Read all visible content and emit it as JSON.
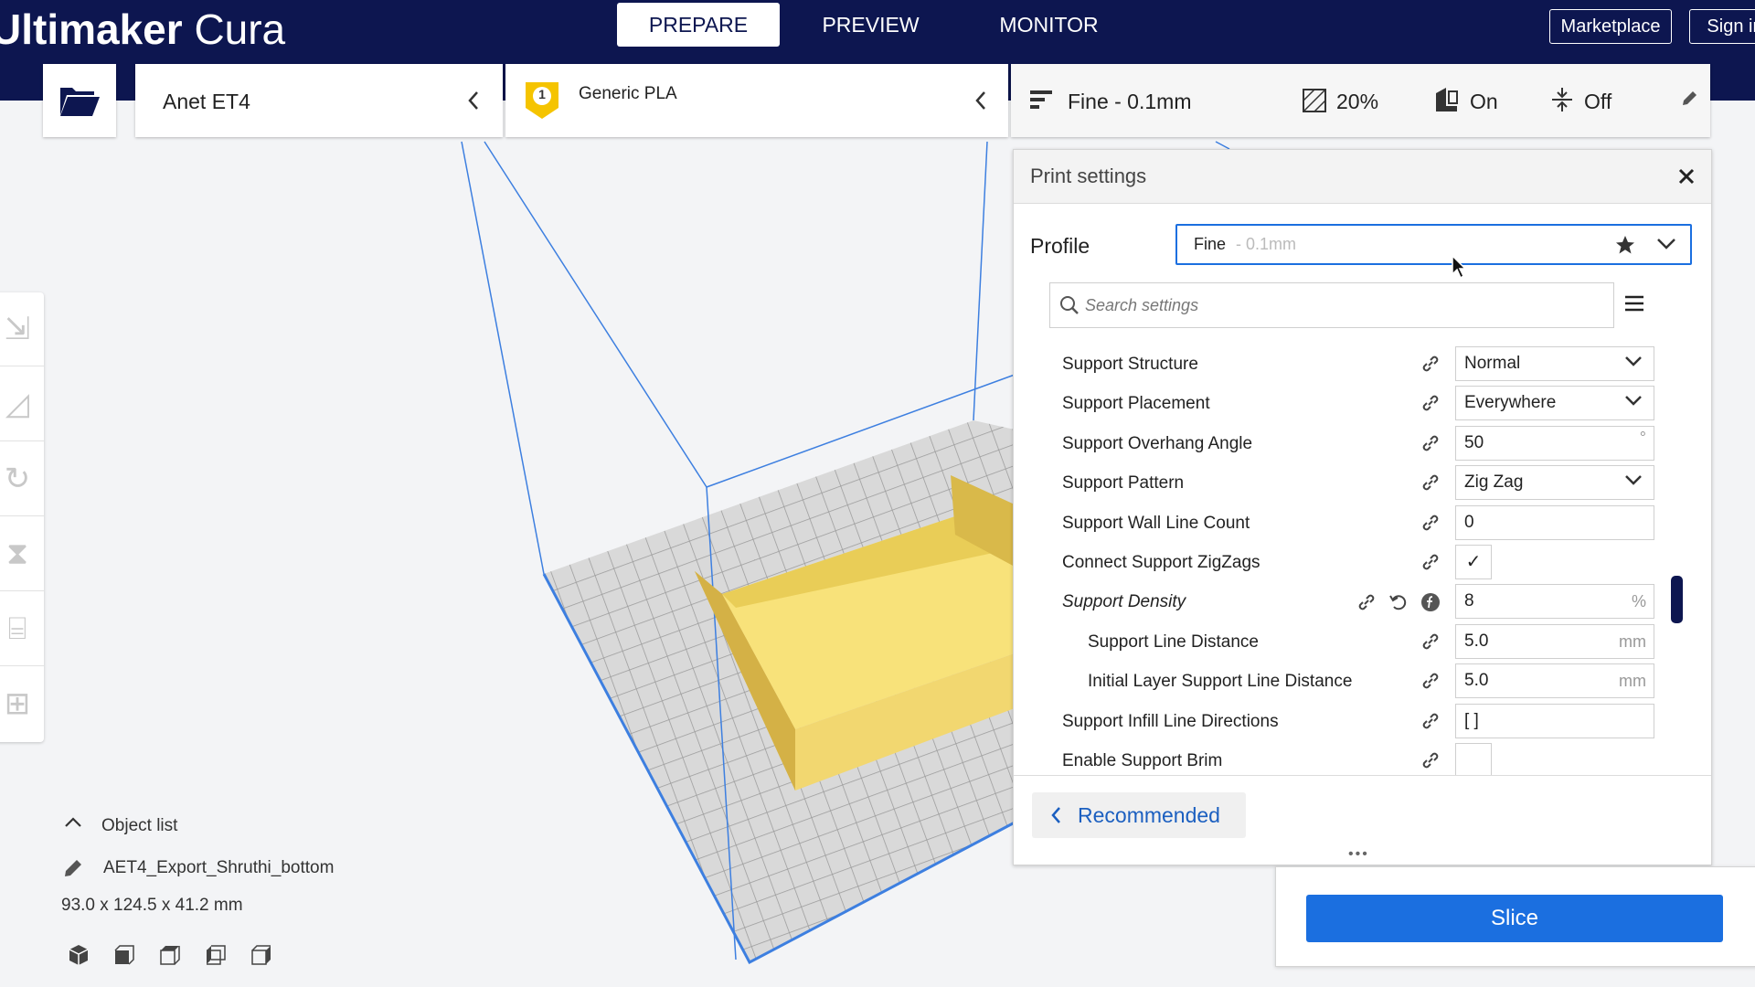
{
  "header": {
    "logo_bold": "Ultimaker",
    "logo_light": "Cura",
    "tabs": [
      "PREPARE",
      "PREVIEW",
      "MONITOR"
    ],
    "marketplace": "Marketplace",
    "sign_in": "Sign in"
  },
  "machine": {
    "printer": "Anet ET4",
    "material_badge": "1",
    "material": "Generic PLA"
  },
  "profile_bar": {
    "quality": "Fine - 0.1mm",
    "infill": "20%",
    "support": "On",
    "adhesion": "Off"
  },
  "panel": {
    "title": "Print settings",
    "profile_label": "Profile",
    "profile_name": "Fine",
    "profile_sub": "- 0.1mm",
    "search_placeholder": "Search settings",
    "recommended": "Recommended",
    "settings": [
      {
        "label": "Support Structure",
        "value": "Normal",
        "unit": ""
      },
      {
        "label": "Support Placement",
        "value": "Everywhere",
        "unit": ""
      },
      {
        "label": "Support Overhang Angle",
        "value": "50",
        "unit": "°"
      },
      {
        "label": "Support Pattern",
        "value": "Zig Zag",
        "unit": ""
      },
      {
        "label": "Support Wall Line Count",
        "value": "0",
        "unit": ""
      },
      {
        "label": "Connect Support ZigZags",
        "value": "✓",
        "unit": ""
      },
      {
        "label": "Support Density",
        "value": "8",
        "unit": "%"
      },
      {
        "label": "Support Line Distance",
        "value": "5.0",
        "unit": "mm"
      },
      {
        "label": "Initial Layer Support Line Distance",
        "value": "5.0",
        "unit": "mm"
      },
      {
        "label": "Support Infill Line Directions",
        "value": "[ ]",
        "unit": ""
      },
      {
        "label": "Enable Support Brim",
        "value": "",
        "unit": ""
      }
    ]
  },
  "objects": {
    "header": "Object list",
    "name": "AET4_Export_Shruthi_bottom",
    "dimensions": "93.0 x 124.5 x 41.2 mm"
  },
  "slice": {
    "label": "Slice"
  },
  "colors": {
    "header": "#0d1650",
    "accent": "#1b6fe0",
    "model": "#f8e27a",
    "plate_line": "#3d7fe0"
  }
}
